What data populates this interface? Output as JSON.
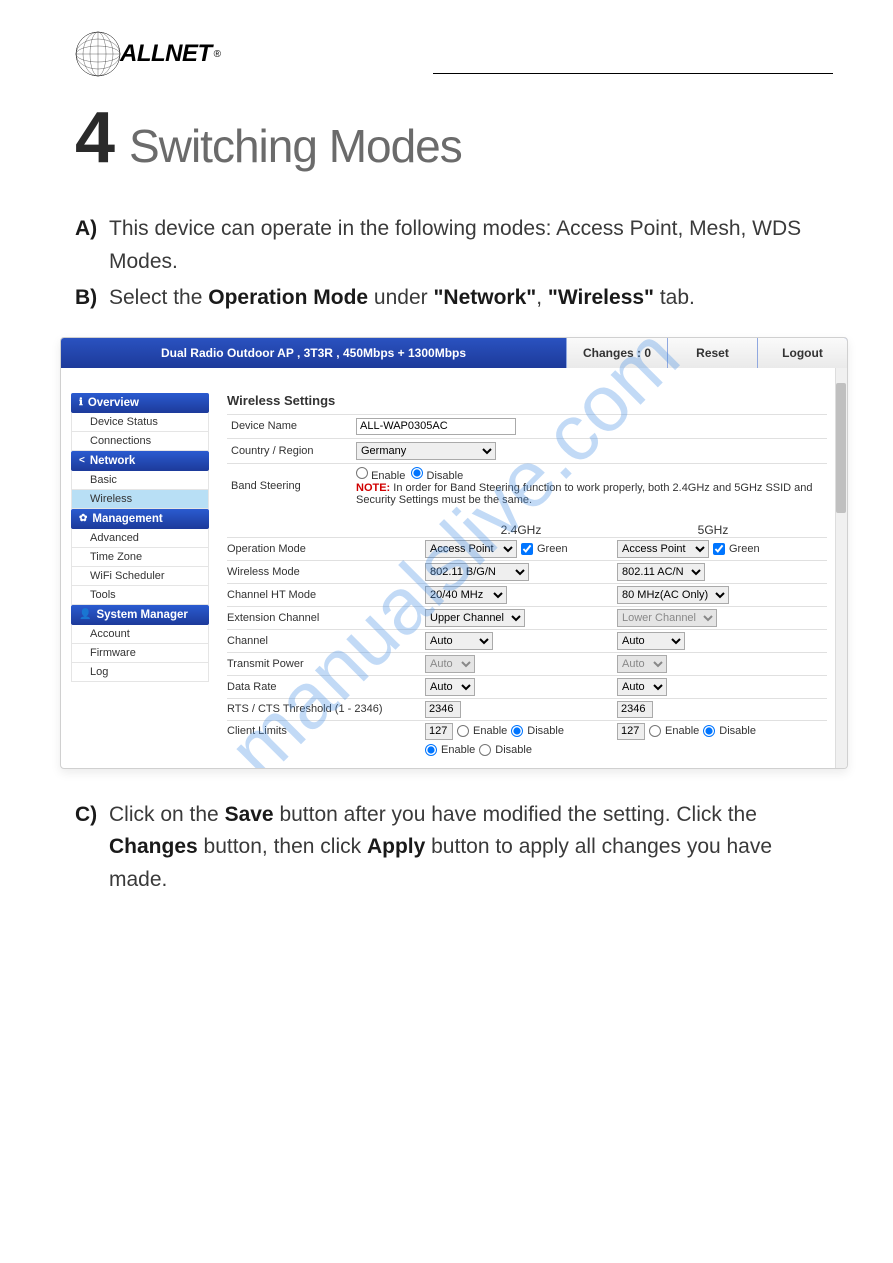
{
  "brand": {
    "name": "ALLNET",
    "reg": "®"
  },
  "section": {
    "number": "4",
    "title": "Switching Modes"
  },
  "steps": {
    "a": {
      "letter": "A)",
      "text": "This device can operate in the following modes: Access Point, Mesh, WDS Modes."
    },
    "b": {
      "letter": "B)",
      "prefix": "Select the ",
      "b1": "Operation Mode",
      "mid": " under ",
      "b2": "\"Network\"",
      "sep": ", ",
      "b3": "\"Wireless\"",
      "suffix": " tab."
    },
    "c": {
      "letter": "C)",
      "p1": "Click on the ",
      "b1": "Save",
      "p2": " button after you have modified the setting. Click the ",
      "b2": "Changes",
      "p3": " button, then click ",
      "b3": "Apply",
      "p4": " button to apply all changes you have made."
    }
  },
  "admin": {
    "title": "Dual Radio Outdoor AP , 3T3R , 450Mbps + 1300Mbps",
    "changes": "Changes : 0",
    "reset": "Reset",
    "logout": "Logout"
  },
  "sidebar": {
    "groups": [
      {
        "icon": "ℹ",
        "label": "Overview",
        "items": [
          "Device Status",
          "Connections"
        ]
      },
      {
        "icon": "<",
        "label": "Network",
        "items": [
          "Basic",
          "Wireless"
        ],
        "active": "Wireless"
      },
      {
        "icon": "✿",
        "label": "Management",
        "items": [
          "Advanced",
          "Time Zone",
          "WiFi Scheduler",
          "Tools"
        ]
      },
      {
        "icon": "👤",
        "label": "System Manager",
        "items": [
          "Account",
          "Firmware",
          "Log"
        ]
      }
    ]
  },
  "panel": {
    "title": "Wireless Settings",
    "device_name_label": "Device Name",
    "device_name": "ALL-WAP0305AC",
    "country_label": "Country / Region",
    "country": "Germany",
    "band_label": "Band Steering",
    "enable": "Enable",
    "disable": "Disable",
    "note_label": "NOTE:",
    "note_text": " In order for Band Steering function to work properly, both 2.4GHz and 5GHz SSID and Security Settings must be the same.",
    "col24": "2.4GHz",
    "col5": "5GHz",
    "rows": {
      "op_mode": {
        "label": "Operation Mode",
        "v24": "Access Point",
        "green24": "Green",
        "v5": "Access Point",
        "green5": "Green"
      },
      "wireless_mode": {
        "label": "Wireless Mode",
        "v24": "802.11 B/G/N",
        "v5": "802.11 AC/N"
      },
      "ht_mode": {
        "label": "Channel HT Mode",
        "v24": "20/40 MHz",
        "v5": "80 MHz(AC Only)"
      },
      "ext_channel": {
        "label": "Extension Channel",
        "v24": "Upper Channel",
        "v5": "Lower Channel"
      },
      "channel": {
        "label": "Channel",
        "v24": "Auto",
        "v5": "Auto"
      },
      "tx_power": {
        "label": "Transmit Power",
        "v24": "Auto",
        "v5": "Auto"
      },
      "data_rate": {
        "label": "Data Rate",
        "v24": "Auto",
        "v5": "Auto"
      },
      "rts": {
        "label": "RTS / CTS Threshold (1 - 2346)",
        "v24": "2346",
        "v5": "2346"
      },
      "client_limits": {
        "label": "Client Limits",
        "v24": "127",
        "v5": "127"
      }
    }
  },
  "watermark": "manualslive.com"
}
